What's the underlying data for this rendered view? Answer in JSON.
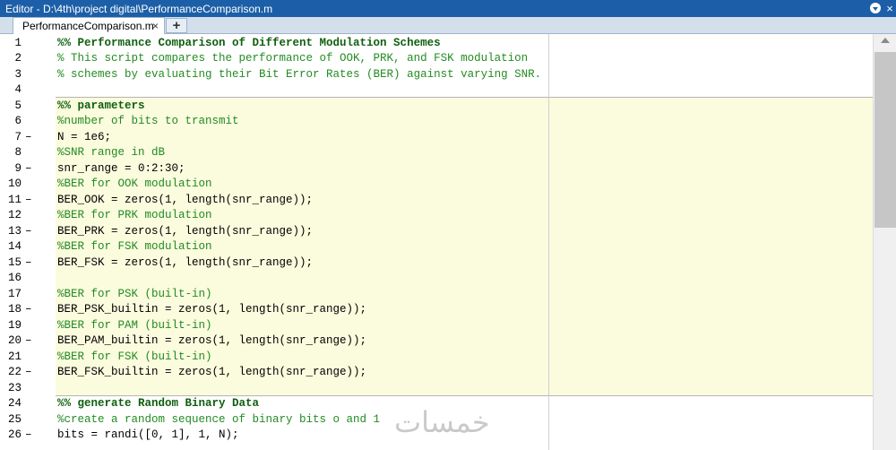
{
  "window": {
    "title": "Editor - D:\\4th\\project digital\\PerformanceComparison.m",
    "menu_icon": "chevron-down-circle-icon",
    "close_glyph": "×"
  },
  "tabs": [
    {
      "label": "PerformanceComparison.m",
      "close_glyph": "×"
    }
  ],
  "tab_add_glyph": "+",
  "watermark": "خمسات",
  "colors": {
    "titlebar": "#1c5fa8",
    "cell_highlight": "#fbfbde",
    "comment": "#228b22",
    "section": "#0e5f0e"
  },
  "lines": [
    {
      "num": "1",
      "dash": "",
      "text": "%% Performance Comparison of Different Modulation Schemes",
      "kind": "section"
    },
    {
      "num": "2",
      "dash": "",
      "text": "% This script compares the performance of OOK, PRK, and FSK modulation",
      "kind": "comment"
    },
    {
      "num": "3",
      "dash": "",
      "text": "% schemes by evaluating their Bit Error Rates (BER) against varying SNR.",
      "kind": "comment"
    },
    {
      "num": "4",
      "dash": "",
      "text": "",
      "kind": "code"
    },
    {
      "num": "5",
      "dash": "",
      "text": "%% parameters",
      "kind": "section"
    },
    {
      "num": "6",
      "dash": "",
      "text": "%number of bits to transmit",
      "kind": "comment"
    },
    {
      "num": "7",
      "dash": "–",
      "text": "N = 1e6;",
      "kind": "code"
    },
    {
      "num": "8",
      "dash": "",
      "text": "%SNR range in dB",
      "kind": "comment"
    },
    {
      "num": "9",
      "dash": "–",
      "text": "snr_range = 0:2:30;",
      "kind": "code"
    },
    {
      "num": "10",
      "dash": "",
      "text": "%BER for OOK modulation",
      "kind": "comment"
    },
    {
      "num": "11",
      "dash": "–",
      "text": "BER_OOK = zeros(1, length(snr_range));",
      "kind": "code"
    },
    {
      "num": "12",
      "dash": "",
      "text": "%BER for PRK modulation",
      "kind": "comment"
    },
    {
      "num": "13",
      "dash": "–",
      "text": "BER_PRK = zeros(1, length(snr_range));",
      "kind": "code"
    },
    {
      "num": "14",
      "dash": "",
      "text": "%BER for FSK modulation",
      "kind": "comment"
    },
    {
      "num": "15",
      "dash": "–",
      "text": "BER_FSK = zeros(1, length(snr_range));",
      "kind": "code"
    },
    {
      "num": "16",
      "dash": "",
      "text": "",
      "kind": "code"
    },
    {
      "num": "17",
      "dash": "",
      "text": "%BER for PSK (built-in)",
      "kind": "comment"
    },
    {
      "num": "18",
      "dash": "–",
      "text": "BER_PSK_builtin = zeros(1, length(snr_range));",
      "kind": "code"
    },
    {
      "num": "19",
      "dash": "",
      "text": "%BER for PAM (built-in)",
      "kind": "comment"
    },
    {
      "num": "20",
      "dash": "–",
      "text": "BER_PAM_builtin = zeros(1, length(snr_range));",
      "kind": "code"
    },
    {
      "num": "21",
      "dash": "",
      "text": "%BER for FSK (built-in)",
      "kind": "comment"
    },
    {
      "num": "22",
      "dash": "–",
      "text": "BER_FSK_builtin = zeros(1, length(snr_range));",
      "kind": "code"
    },
    {
      "num": "23",
      "dash": "",
      "text": "",
      "kind": "code"
    },
    {
      "num": "24",
      "dash": "",
      "text": "%% generate Random Binary Data",
      "kind": "section"
    },
    {
      "num": "25",
      "dash": "",
      "text": "%create a random sequence of binary bits o and 1",
      "kind": "comment"
    },
    {
      "num": "26",
      "dash": "–",
      "text": "bits = randi([0, 1], 1, N);",
      "kind": "code"
    }
  ]
}
